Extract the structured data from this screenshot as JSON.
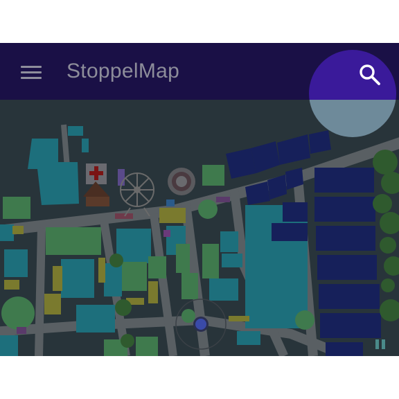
{
  "app": {
    "title": "StoppelMap"
  },
  "toolbar": {
    "menu_icon": "hamburger-menu-icon",
    "search_icon": "search-icon"
  },
  "theme": {
    "appbar": "#1a1046",
    "map_bg": "#28343a",
    "road": "#595f63",
    "highlight": "#3a1a9a",
    "highlight_lower": "#6e8a9a",
    "location_dot": "#3a4aa8"
  }
}
